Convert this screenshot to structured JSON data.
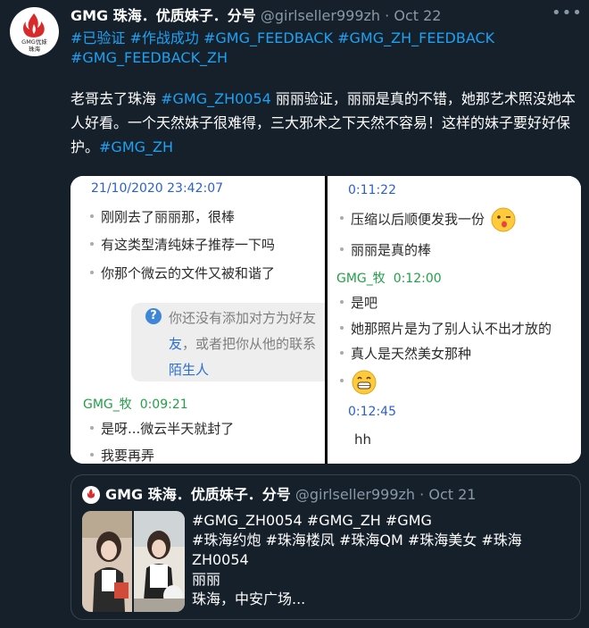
{
  "tweet": {
    "display_name": "GMG 珠海．优质妹子．分号",
    "handle": "@girlseller999zh",
    "separator": "·",
    "time": "Oct 22",
    "more": "•••",
    "avatar_text_1": "GMG优妹",
    "avatar_text_2": "珠海",
    "hashtags_line1": "#已验证 #作战成功 #GMG_FEEDBACK #GMG_ZH_FEEDBACK",
    "hashtags_line2": "#GMG_FEEDBACK_ZH",
    "body_part1": "老哥去了珠海 ",
    "body_tag": "#GMG_ZH0054",
    "body_part2": " 丽丽验证，丽丽是真的不错，她那艺术照没她本人好看。一个天然妹子很难得，三大邪术之下天然不容易！这样的妹子要好好保护。",
    "body_tag2": "#GMG_ZH"
  },
  "chat_left": {
    "timestamp": "21/10/2020 23:42:07",
    "messages": [
      "刚刚去了丽丽那，很棒",
      "有这类型清纯妹子推荐一下吗",
      "你那个微云的文件又被和谐了"
    ],
    "notice_line1": "你还没有添加对方为好友",
    "notice_line2a": "友",
    "notice_line2b": "，或者把你从他的联系",
    "notice_line3": "陌生人",
    "sender": "GMG_牧",
    "sender_time": "0:09:21",
    "reply1": "是呀...微云半天就封了",
    "reply2": "我要再弄"
  },
  "chat_right": {
    "timestamp1": "0:11:22",
    "msg1": "压缩以后顺便发我一份",
    "msg2": "丽丽是真的棒",
    "sender": "GMG_牧",
    "sender_time": "0:12:00",
    "reply1": "是吧",
    "reply2": "她那照片是为了别人认不出才放的",
    "reply3": "真人是天然美女那种",
    "timestamp2": "0:12:45",
    "msg3": "hh"
  },
  "quote": {
    "display_name": "GMG 珠海．优质妹子．分号",
    "handle": "@girlseller999zh",
    "separator": "·",
    "time": "Oct 21",
    "line1": "#GMG_ZH0054 #GMG_ZH #GMG",
    "line2": "#珠海约炮 #珠海楼凤 #珠海QM #珠海美女 #珠海",
    "line3": "ZH0054",
    "line4": "丽丽",
    "line5": "珠海，中安广场..."
  },
  "colors": {
    "background": "#15202b",
    "link": "#1da1f2",
    "muted": "#8899a6",
    "chat_timestamp": "#2a5fd6",
    "chat_sender": "#21a047"
  }
}
